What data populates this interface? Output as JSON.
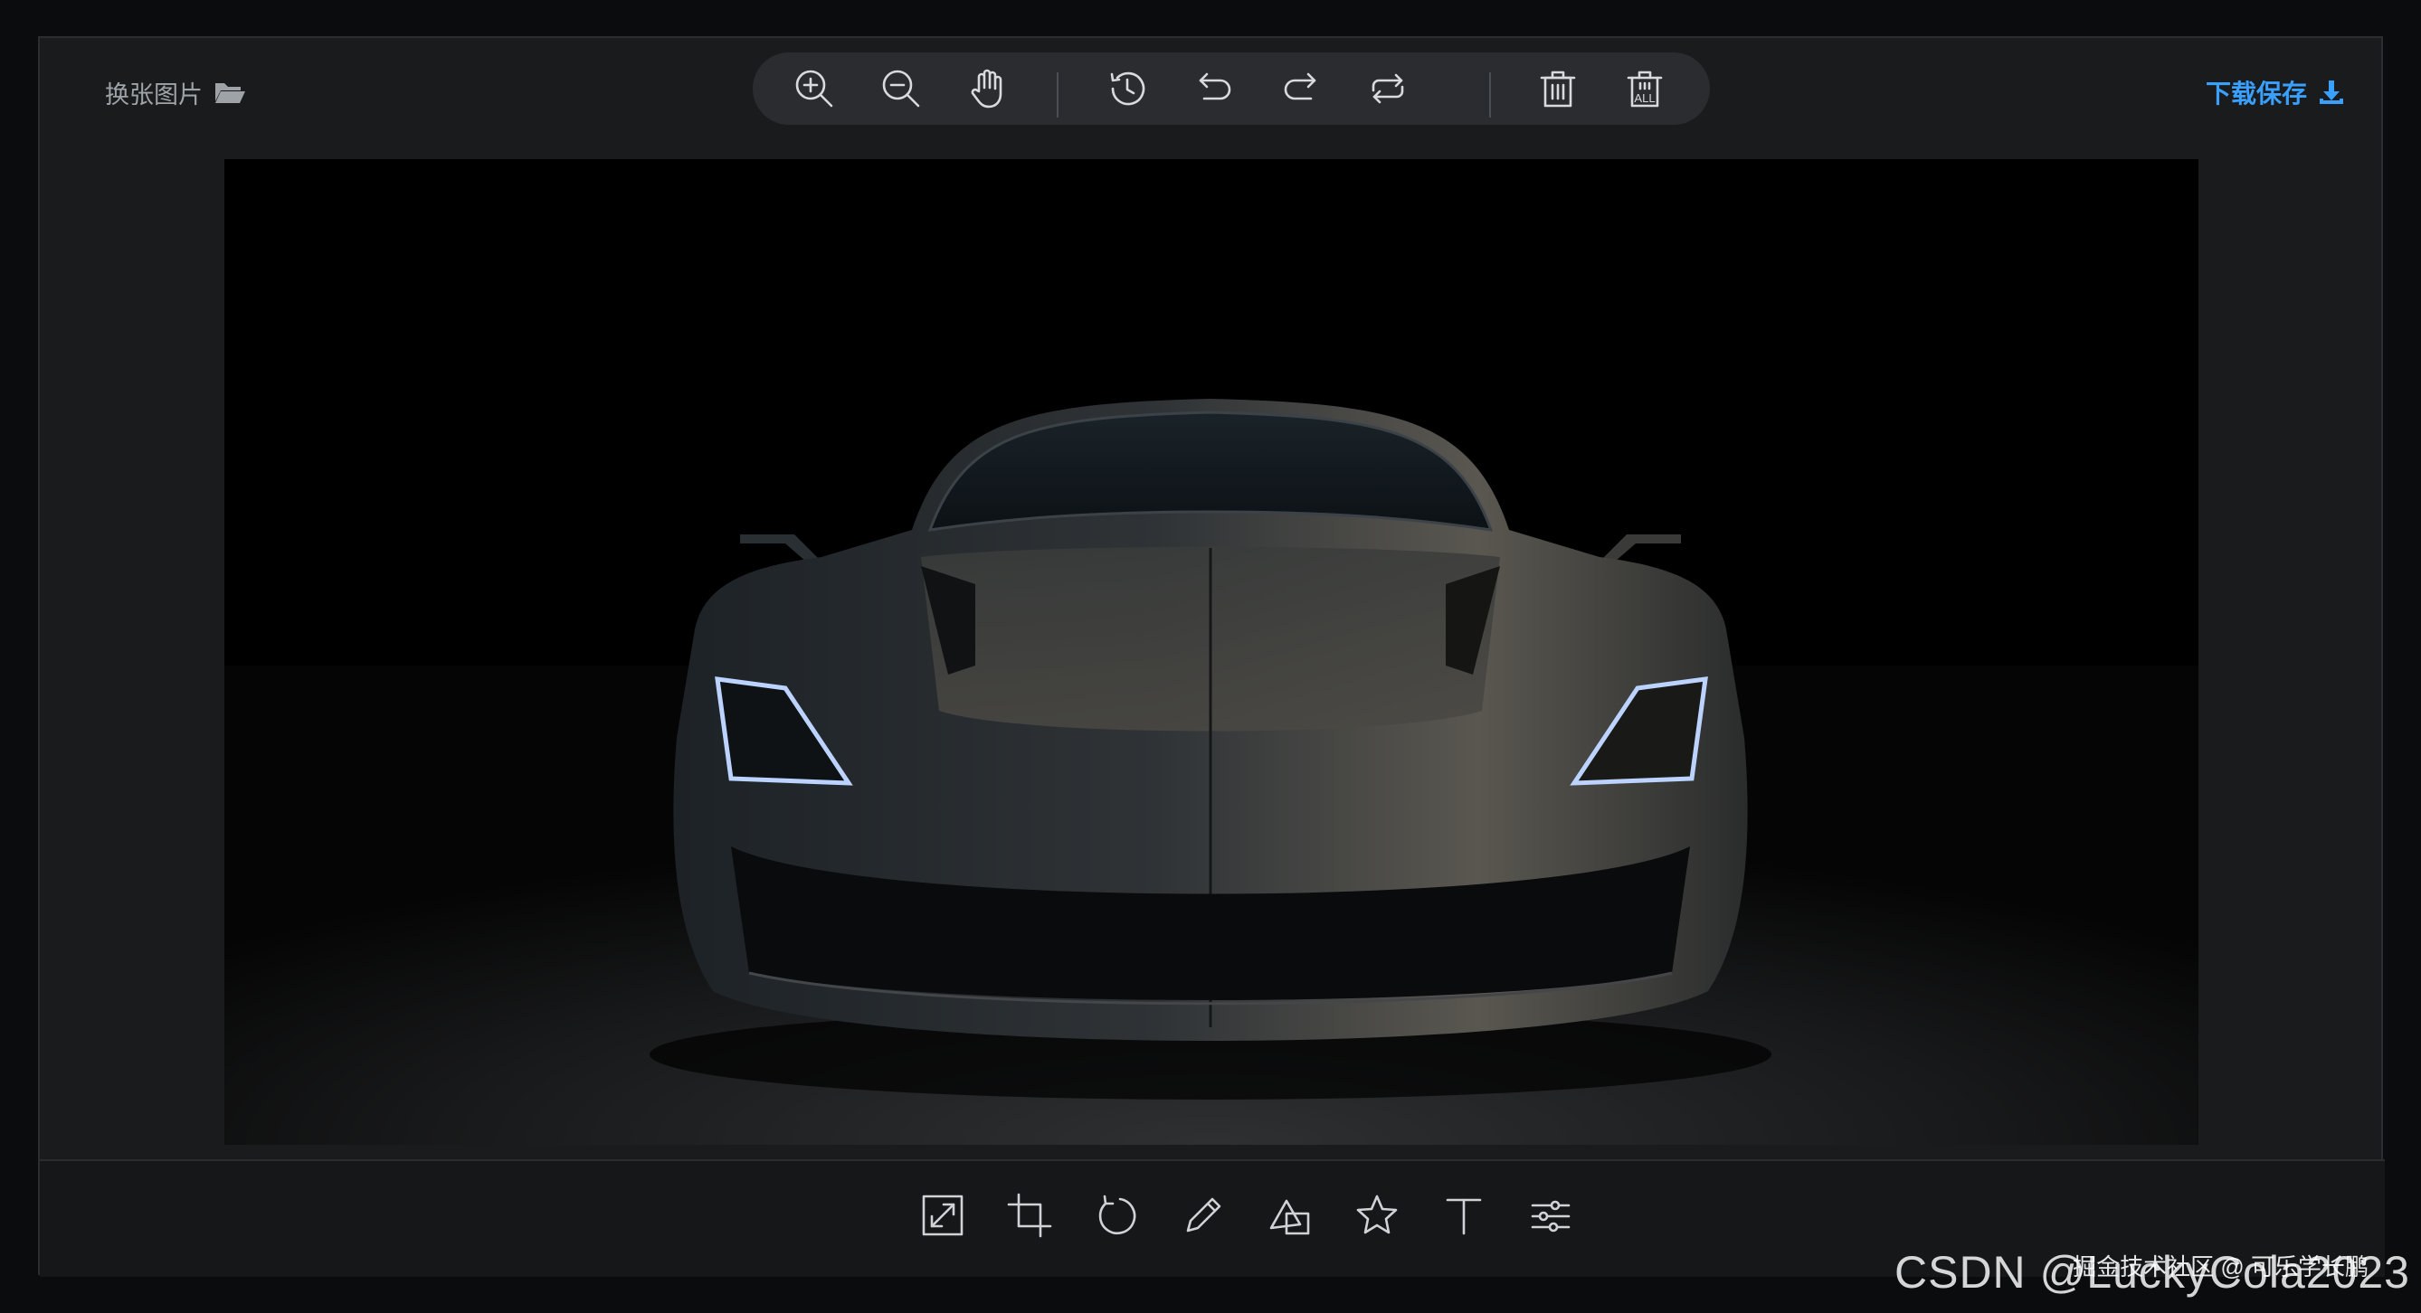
{
  "header": {
    "change_image_label": "换张图片",
    "change_image_icon": "folder-open-icon",
    "download_label": "下载保存",
    "download_icon": "download-icon"
  },
  "toolbar": {
    "tools": [
      "zoom-in-icon",
      "zoom-out-icon",
      "hand-pan-icon",
      "history-icon",
      "undo-icon",
      "redo-icon",
      "reset-icon",
      "delete-icon",
      "delete-all-icon"
    ],
    "delete_all_text": "ALL"
  },
  "bottom_toolbar": {
    "tools": [
      "resize-icon",
      "crop-icon",
      "rotate-icon",
      "draw-icon",
      "shape-icon",
      "star-icon",
      "text-icon",
      "adjust-filter-icon"
    ],
    "text_tool_glyph": "T"
  },
  "image": {
    "subject": "dark sports car front view"
  },
  "watermark": {
    "csdn": "CSDN @LuckyCola2023",
    "juejin": "掘金技术社区 @ 可乐学长鹏"
  },
  "colors": {
    "accent": "#3aa0ff",
    "panel": "#1a1b1d",
    "toolbar": "#2a2c2f",
    "headlight": "#bcd2ff"
  }
}
